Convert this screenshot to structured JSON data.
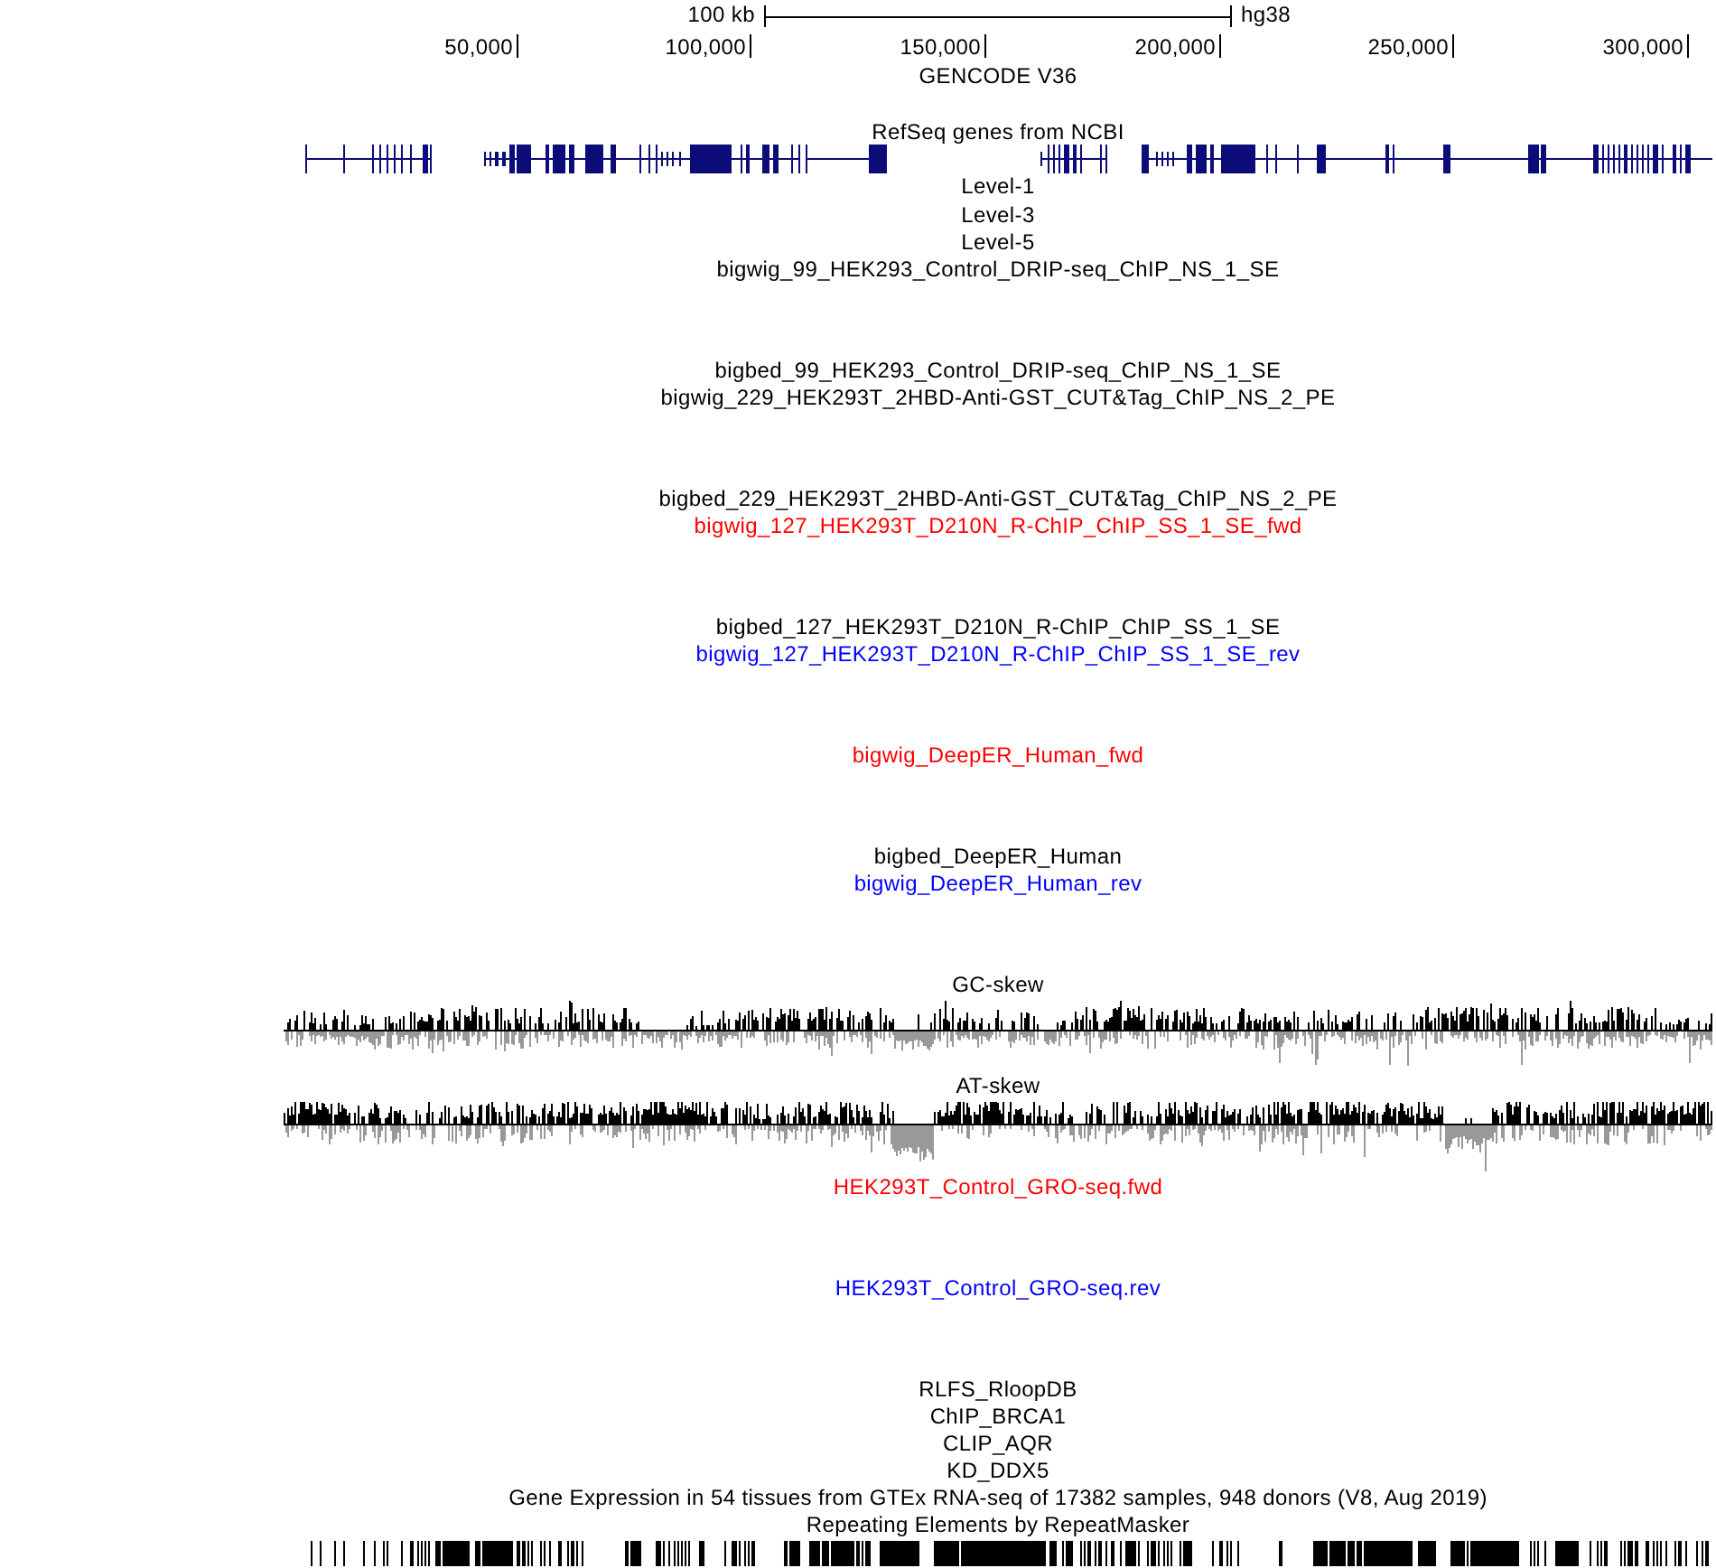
{
  "ruler": {
    "scale_label": "100 kb",
    "assembly": "hg38",
    "positions": [
      "50,000",
      "100,000",
      "150,000",
      "200,000",
      "250,000",
      "300,000"
    ]
  },
  "tracks": [
    {
      "label": "GENCODE V36",
      "kind": "dense",
      "color": "#000000"
    },
    {
      "label": "RefSeq genes from NCBI",
      "kind": "genes",
      "color": "#000000"
    },
    {
      "label": "Level-1",
      "kind": "label",
      "color": "#000000"
    },
    {
      "label": "Level-3",
      "kind": "label",
      "color": "#000000"
    },
    {
      "label": "Level-5",
      "kind": "label",
      "color": "#000000"
    },
    {
      "label": "bigwig_99_HEK293_Control_DRIP-seq_ChIP_NS_1_SE",
      "kind": "signal",
      "color": "#000000"
    },
    {
      "label": "bigbed_99_HEK293_Control_DRIP-seq_ChIP_NS_1_SE",
      "kind": "label",
      "color": "#000000"
    },
    {
      "label": "bigwig_229_HEK293T_2HBD-Anti-GST_CUT&Tag_ChIP_NS_2_PE",
      "kind": "signal",
      "color": "#000000"
    },
    {
      "label": "bigbed_229_HEK293T_2HBD-Anti-GST_CUT&Tag_ChIP_NS_2_PE",
      "kind": "label",
      "color": "#000000"
    },
    {
      "label": "bigwig_127_HEK293T_D210N_R-ChIP_ChIP_SS_1_SE_fwd",
      "kind": "signal",
      "color": "#ff0000"
    },
    {
      "label": "bigbed_127_HEK293T_D210N_R-ChIP_ChIP_SS_1_SE",
      "kind": "label",
      "color": "#000000"
    },
    {
      "label": "bigwig_127_HEK293T_D210N_R-ChIP_ChIP_SS_1_SE_rev",
      "kind": "signal",
      "color": "#0000ff"
    },
    {
      "label": "bigwig_DeepER_Human_fwd",
      "kind": "signal",
      "color": "#ff0000"
    },
    {
      "label": "bigbed_DeepER_Human",
      "kind": "label",
      "color": "#000000"
    },
    {
      "label": "bigwig_DeepER_Human_rev",
      "kind": "signal",
      "color": "#0000ff"
    },
    {
      "label": "GC-skew",
      "kind": "skew",
      "color": "#000000"
    },
    {
      "label": "AT-skew",
      "kind": "skew",
      "color": "#000000"
    },
    {
      "label": "HEK293T_Control_GRO-seq.fwd",
      "kind": "signal",
      "color": "#ff0000"
    },
    {
      "label": "HEK293T_Control_GRO-seq.rev",
      "kind": "signal",
      "color": "#0000ff"
    },
    {
      "label": "RLFS_RloopDB",
      "kind": "label",
      "color": "#000000"
    },
    {
      "label": "ChIP_BRCA1",
      "kind": "label",
      "color": "#000000"
    },
    {
      "label": "CLIP_AQR",
      "kind": "label",
      "color": "#000000"
    },
    {
      "label": "KD_DDX5",
      "kind": "label",
      "color": "#000000"
    },
    {
      "label": "Gene Expression in 54 tissues from GTEx RNA-seq of 17382 samples, 948 donors (V8, Aug 2019)",
      "kind": "label",
      "color": "#000000"
    },
    {
      "label": "Repeating Elements by RepeatMasker",
      "kind": "repeats",
      "color": "#000000"
    }
  ]
}
